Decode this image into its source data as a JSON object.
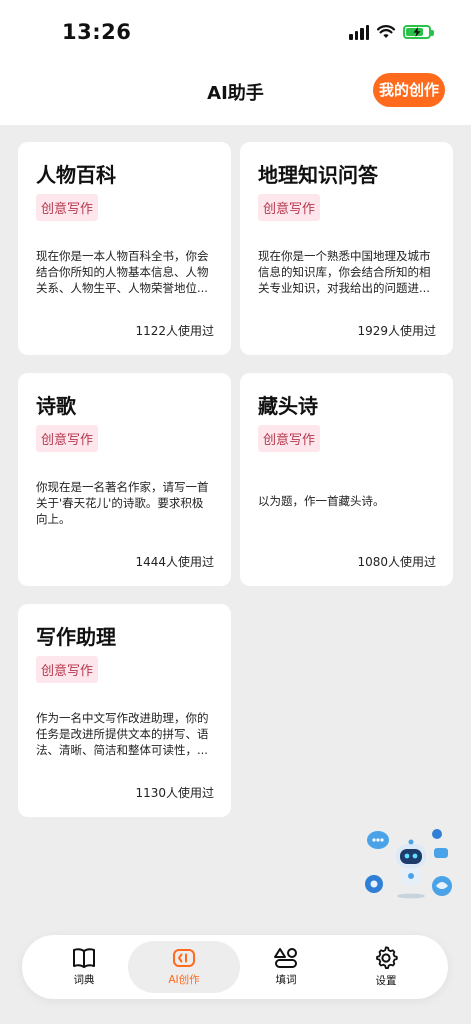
{
  "status": {
    "time": "13:26"
  },
  "header": {
    "title": "AI助手",
    "my_creation_label": "我的创作"
  },
  "cards": [
    {
      "title": "人物百科",
      "tag": "创意写作",
      "desc": "现在你是一本人物百科全书，你会结合你所知的人物基本信息、人物关系、人物生平、人物荣誉地位...",
      "usage": "1122人使用过"
    },
    {
      "title": "地理知识问答",
      "tag": "创意写作",
      "desc": "现在你是一个熟悉中国地理及城市信息的知识库，你会结合所知的相关专业知识，对我给出的问题进...",
      "usage": "1929人使用过"
    },
    {
      "title": "诗歌",
      "tag": "创意写作",
      "desc": "你现在是一名著名作家，请写一首关于'春天花儿'的诗歌。要求积极向上。",
      "usage": "1444人使用过"
    },
    {
      "title": "藏头诗",
      "tag": "创意写作",
      "desc": "以为题，作一首藏头诗。",
      "usage": "1080人使用过"
    },
    {
      "title": "写作助理",
      "tag": "创意写作",
      "desc": "作为一名中文写作改进助理，你的任务是改进所提供文本的拼写、语法、清晰、简洁和整体可读性，...",
      "usage": "1130人使用过"
    }
  ],
  "tabs": [
    {
      "label": "词典",
      "icon": "book-icon"
    },
    {
      "label": "AI创作",
      "icon": "ai-create-icon"
    },
    {
      "label": "填词",
      "icon": "shapes-icon"
    },
    {
      "label": "设置",
      "icon": "gear-icon"
    }
  ],
  "colors": {
    "accent": "#ff6a1c",
    "tag_bg": "#fde7ec",
    "tag_text": "#b6384f",
    "page_bg": "#ededed"
  }
}
